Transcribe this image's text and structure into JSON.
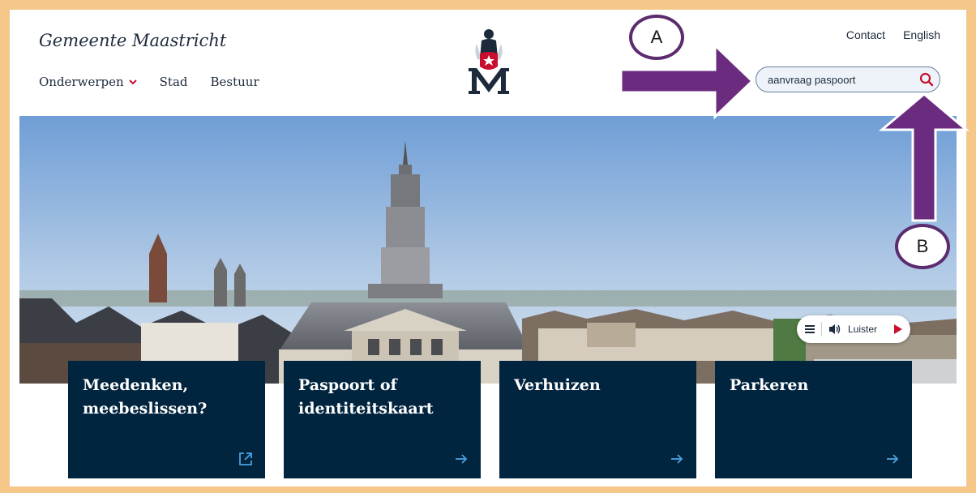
{
  "header": {
    "site_title": "Gemeente Maastricht",
    "main_nav": [
      {
        "label": "Onderwerpen",
        "has_dropdown": true
      },
      {
        "label": "Stad"
      },
      {
        "label": "Bestuur"
      }
    ],
    "top_nav": [
      {
        "label": "Contact"
      },
      {
        "label": "English"
      }
    ],
    "search": {
      "value": "aanvraag paspoort"
    }
  },
  "listen_widget": {
    "label": "Luister"
  },
  "cards": [
    {
      "title": "Meedenken, meebeslissen?",
      "icon": "external-link-icon"
    },
    {
      "title": "Paspoort of identiteitskaart",
      "icon": "arrow-right-icon"
    },
    {
      "title": "Verhuizen",
      "icon": "arrow-right-icon"
    },
    {
      "title": "Parkeren",
      "icon": "arrow-right-icon"
    }
  ],
  "annotations": [
    {
      "label": "A"
    },
    {
      "label": "B"
    }
  ],
  "colors": {
    "brand_navy": "#01243f",
    "accent_red": "#c8102e",
    "annotation_purple": "#6b2c7f",
    "frame": "#f5c88a",
    "link_blue": "#4aa3df"
  }
}
